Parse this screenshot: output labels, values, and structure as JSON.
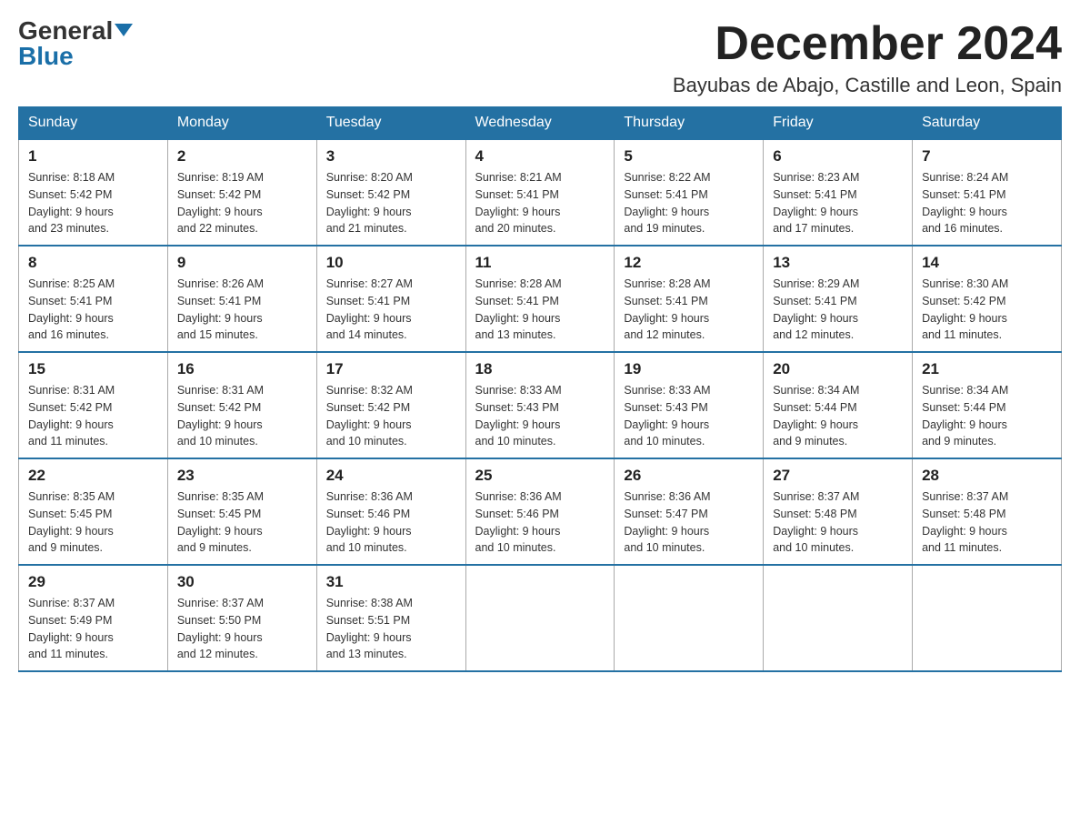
{
  "header": {
    "logo_general": "General",
    "logo_blue": "Blue",
    "month_title": "December 2024",
    "location": "Bayubas de Abajo, Castille and Leon, Spain"
  },
  "days_of_week": [
    "Sunday",
    "Monday",
    "Tuesday",
    "Wednesday",
    "Thursday",
    "Friday",
    "Saturday"
  ],
  "weeks": [
    [
      {
        "day": "1",
        "sunrise": "8:18 AM",
        "sunset": "5:42 PM",
        "daylight": "9 hours and 23 minutes."
      },
      {
        "day": "2",
        "sunrise": "8:19 AM",
        "sunset": "5:42 PM",
        "daylight": "9 hours and 22 minutes."
      },
      {
        "day": "3",
        "sunrise": "8:20 AM",
        "sunset": "5:42 PM",
        "daylight": "9 hours and 21 minutes."
      },
      {
        "day": "4",
        "sunrise": "8:21 AM",
        "sunset": "5:41 PM",
        "daylight": "9 hours and 20 minutes."
      },
      {
        "day": "5",
        "sunrise": "8:22 AM",
        "sunset": "5:41 PM",
        "daylight": "9 hours and 19 minutes."
      },
      {
        "day": "6",
        "sunrise": "8:23 AM",
        "sunset": "5:41 PM",
        "daylight": "9 hours and 17 minutes."
      },
      {
        "day": "7",
        "sunrise": "8:24 AM",
        "sunset": "5:41 PM",
        "daylight": "9 hours and 16 minutes."
      }
    ],
    [
      {
        "day": "8",
        "sunrise": "8:25 AM",
        "sunset": "5:41 PM",
        "daylight": "9 hours and 16 minutes."
      },
      {
        "day": "9",
        "sunrise": "8:26 AM",
        "sunset": "5:41 PM",
        "daylight": "9 hours and 15 minutes."
      },
      {
        "day": "10",
        "sunrise": "8:27 AM",
        "sunset": "5:41 PM",
        "daylight": "9 hours and 14 minutes."
      },
      {
        "day": "11",
        "sunrise": "8:28 AM",
        "sunset": "5:41 PM",
        "daylight": "9 hours and 13 minutes."
      },
      {
        "day": "12",
        "sunrise": "8:28 AM",
        "sunset": "5:41 PM",
        "daylight": "9 hours and 12 minutes."
      },
      {
        "day": "13",
        "sunrise": "8:29 AM",
        "sunset": "5:41 PM",
        "daylight": "9 hours and 12 minutes."
      },
      {
        "day": "14",
        "sunrise": "8:30 AM",
        "sunset": "5:42 PM",
        "daylight": "9 hours and 11 minutes."
      }
    ],
    [
      {
        "day": "15",
        "sunrise": "8:31 AM",
        "sunset": "5:42 PM",
        "daylight": "9 hours and 11 minutes."
      },
      {
        "day": "16",
        "sunrise": "8:31 AM",
        "sunset": "5:42 PM",
        "daylight": "9 hours and 10 minutes."
      },
      {
        "day": "17",
        "sunrise": "8:32 AM",
        "sunset": "5:42 PM",
        "daylight": "9 hours and 10 minutes."
      },
      {
        "day": "18",
        "sunrise": "8:33 AM",
        "sunset": "5:43 PM",
        "daylight": "9 hours and 10 minutes."
      },
      {
        "day": "19",
        "sunrise": "8:33 AM",
        "sunset": "5:43 PM",
        "daylight": "9 hours and 10 minutes."
      },
      {
        "day": "20",
        "sunrise": "8:34 AM",
        "sunset": "5:44 PM",
        "daylight": "9 hours and 9 minutes."
      },
      {
        "day": "21",
        "sunrise": "8:34 AM",
        "sunset": "5:44 PM",
        "daylight": "9 hours and 9 minutes."
      }
    ],
    [
      {
        "day": "22",
        "sunrise": "8:35 AM",
        "sunset": "5:45 PM",
        "daylight": "9 hours and 9 minutes."
      },
      {
        "day": "23",
        "sunrise": "8:35 AM",
        "sunset": "5:45 PM",
        "daylight": "9 hours and 9 minutes."
      },
      {
        "day": "24",
        "sunrise": "8:36 AM",
        "sunset": "5:46 PM",
        "daylight": "9 hours and 10 minutes."
      },
      {
        "day": "25",
        "sunrise": "8:36 AM",
        "sunset": "5:46 PM",
        "daylight": "9 hours and 10 minutes."
      },
      {
        "day": "26",
        "sunrise": "8:36 AM",
        "sunset": "5:47 PM",
        "daylight": "9 hours and 10 minutes."
      },
      {
        "day": "27",
        "sunrise": "8:37 AM",
        "sunset": "5:48 PM",
        "daylight": "9 hours and 10 minutes."
      },
      {
        "day": "28",
        "sunrise": "8:37 AM",
        "sunset": "5:48 PM",
        "daylight": "9 hours and 11 minutes."
      }
    ],
    [
      {
        "day": "29",
        "sunrise": "8:37 AM",
        "sunset": "5:49 PM",
        "daylight": "9 hours and 11 minutes."
      },
      {
        "day": "30",
        "sunrise": "8:37 AM",
        "sunset": "5:50 PM",
        "daylight": "9 hours and 12 minutes."
      },
      {
        "day": "31",
        "sunrise": "8:38 AM",
        "sunset": "5:51 PM",
        "daylight": "9 hours and 13 minutes."
      },
      null,
      null,
      null,
      null
    ]
  ]
}
